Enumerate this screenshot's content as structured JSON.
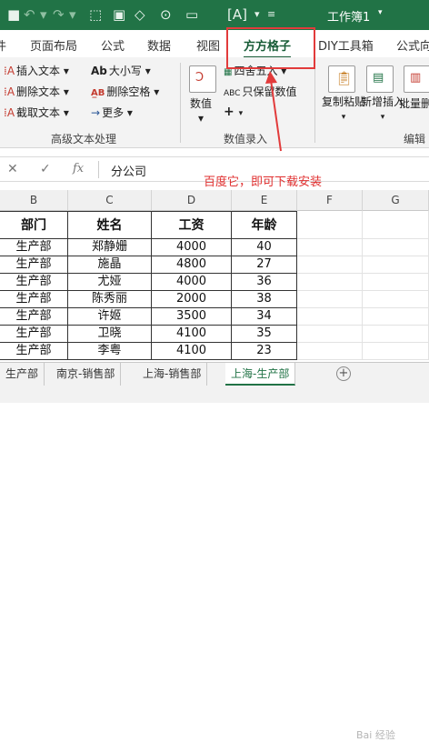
{
  "quick_access": {
    "icons": [
      "undo-icon",
      "redo-icon",
      "shape-icon",
      "bracket-icon",
      "format-painter-icon",
      "dropdown-icon"
    ],
    "workbook_title": "工作簿1"
  },
  "tabs": [
    "页面布局",
    "公式",
    "数据",
    "视图",
    "方方格子",
    "DIY工具箱",
    "公式向"
  ],
  "active_tab": "方方格子",
  "ribbon": {
    "advanced_text": {
      "items": [
        "插入文本",
        "删除文本",
        "截取文本",
        "大小写",
        "删除空格",
        "更多"
      ],
      "group_label": "高级文本处理"
    },
    "data_entry": {
      "numeric_label": "数值",
      "items": [
        "四舍五入",
        "只保留数值"
      ],
      "group_label": "数值录入"
    },
    "edit": {
      "items": [
        "复制粘贴",
        "新增插入",
        "批量删"
      ],
      "group_label": "编辑"
    },
    "accent_color": "#217346"
  },
  "formula_bar": {
    "cancel": "✕",
    "confirm": "✓",
    "fx": "fx",
    "content": "分公司"
  },
  "annotation": "百度它，即可下载安装",
  "column_headers": [
    "B",
    "C",
    "D",
    "E",
    "F",
    "G"
  ],
  "table": {
    "headers": [
      "部门",
      "姓名",
      "工资",
      "年龄"
    ],
    "rows": [
      [
        "生产部",
        "郑静姗",
        "4000",
        "40"
      ],
      [
        "生产部",
        "施晶",
        "4800",
        "27"
      ],
      [
        "生产部",
        "尤娅",
        "4000",
        "36"
      ],
      [
        "生产部",
        "陈秀丽",
        "2000",
        "38"
      ],
      [
        "生产部",
        "许姬",
        "3500",
        "34"
      ],
      [
        "生产部",
        "卫晓",
        "4100",
        "35"
      ],
      [
        "生产部",
        "李粤",
        "4100",
        "23"
      ]
    ]
  },
  "sheet_tabs": [
    "生产部",
    "南京-销售部",
    "上海-销售部",
    "上海-生产部"
  ],
  "active_sheet": "上海-生产部",
  "watermark": "Bai 经验"
}
